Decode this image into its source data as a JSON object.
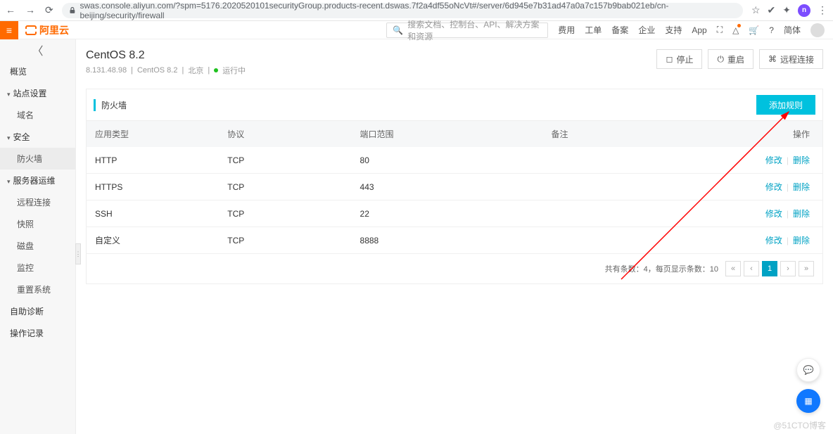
{
  "browser": {
    "url": "swas.console.aliyun.com/?spm=5176.2020520101securityGroup.products-recent.dswas.7f2a4df55oNcVt#/server/6d945e7b31ad47a0a7c157b9bab021eb/cn-beijing/security/firewall"
  },
  "header": {
    "logo_text": "阿里云",
    "search_placeholder": "搜索文档、控制台、API、解决方案和资源",
    "links": [
      "费用",
      "工单",
      "备案",
      "企业",
      "支持",
      "App"
    ],
    "lang": "简体"
  },
  "sidebar": {
    "items": [
      {
        "type": "item",
        "label": "概览"
      },
      {
        "type": "group",
        "label": "站点设置"
      },
      {
        "type": "sub",
        "label": "域名"
      },
      {
        "type": "group",
        "label": "安全"
      },
      {
        "type": "sub",
        "label": "防火墙",
        "active": true
      },
      {
        "type": "group",
        "label": "服务器运维"
      },
      {
        "type": "sub",
        "label": "远程连接"
      },
      {
        "type": "sub",
        "label": "快照"
      },
      {
        "type": "sub",
        "label": "磁盘"
      },
      {
        "type": "sub",
        "label": "监控"
      },
      {
        "type": "sub",
        "label": "重置系统"
      },
      {
        "type": "item",
        "label": "自助诊断"
      },
      {
        "type": "item",
        "label": "操作记录"
      }
    ]
  },
  "page": {
    "title": "CentOS 8.2",
    "ip": "8.131.48.98",
    "os": "CentOS 8.2",
    "region": "北京",
    "status": "运行中",
    "buttons": {
      "stop": "停止",
      "restart": "重启",
      "remote": "远程连接"
    }
  },
  "panel": {
    "title": "防火墙",
    "add_label": "添加规则",
    "columns": {
      "app": "应用类型",
      "proto": "协议",
      "port": "端口范围",
      "remark": "备注",
      "op": "操作"
    },
    "op_labels": {
      "edit": "修改",
      "delete": "删除"
    },
    "rows": [
      {
        "app": "HTTP",
        "proto": "TCP",
        "port": "80",
        "remark": ""
      },
      {
        "app": "HTTPS",
        "proto": "TCP",
        "port": "443",
        "remark": ""
      },
      {
        "app": "SSH",
        "proto": "TCP",
        "port": "22",
        "remark": ""
      },
      {
        "app": "自定义",
        "proto": "TCP",
        "port": "8888",
        "remark": ""
      }
    ],
    "footer": {
      "total_label": "共有条数：",
      "total": "4",
      "pagesize_label": "，每页显示条数：",
      "pagesize": "10",
      "page": "1"
    }
  },
  "watermark": "@51CTO博客"
}
